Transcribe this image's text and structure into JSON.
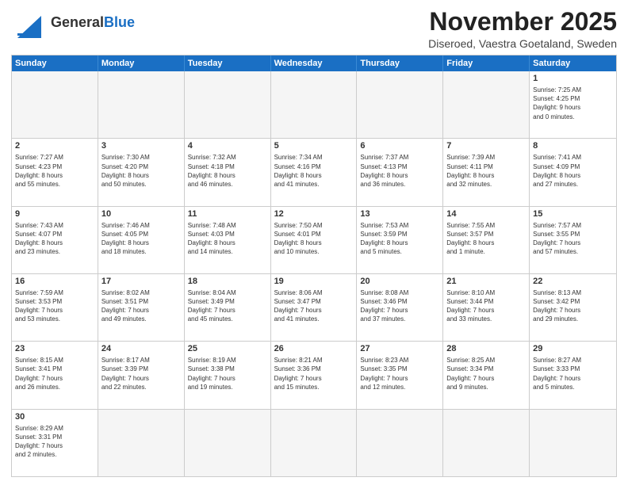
{
  "header": {
    "logo_general": "General",
    "logo_blue": "Blue",
    "month_title": "November 2025",
    "location": "Diseroed, Vaestra Goetaland, Sweden"
  },
  "day_headers": [
    "Sunday",
    "Monday",
    "Tuesday",
    "Wednesday",
    "Thursday",
    "Friday",
    "Saturday"
  ],
  "weeks": [
    [
      {
        "day": "",
        "info": ""
      },
      {
        "day": "",
        "info": ""
      },
      {
        "day": "",
        "info": ""
      },
      {
        "day": "",
        "info": ""
      },
      {
        "day": "",
        "info": ""
      },
      {
        "day": "",
        "info": ""
      },
      {
        "day": "1",
        "info": "Sunrise: 7:25 AM\nSunset: 4:25 PM\nDaylight: 9 hours\nand 0 minutes."
      }
    ],
    [
      {
        "day": "2",
        "info": "Sunrise: 7:27 AM\nSunset: 4:23 PM\nDaylight: 8 hours\nand 55 minutes."
      },
      {
        "day": "3",
        "info": "Sunrise: 7:30 AM\nSunset: 4:20 PM\nDaylight: 8 hours\nand 50 minutes."
      },
      {
        "day": "4",
        "info": "Sunrise: 7:32 AM\nSunset: 4:18 PM\nDaylight: 8 hours\nand 46 minutes."
      },
      {
        "day": "5",
        "info": "Sunrise: 7:34 AM\nSunset: 4:16 PM\nDaylight: 8 hours\nand 41 minutes."
      },
      {
        "day": "6",
        "info": "Sunrise: 7:37 AM\nSunset: 4:13 PM\nDaylight: 8 hours\nand 36 minutes."
      },
      {
        "day": "7",
        "info": "Sunrise: 7:39 AM\nSunset: 4:11 PM\nDaylight: 8 hours\nand 32 minutes."
      },
      {
        "day": "8",
        "info": "Sunrise: 7:41 AM\nSunset: 4:09 PM\nDaylight: 8 hours\nand 27 minutes."
      }
    ],
    [
      {
        "day": "9",
        "info": "Sunrise: 7:43 AM\nSunset: 4:07 PM\nDaylight: 8 hours\nand 23 minutes."
      },
      {
        "day": "10",
        "info": "Sunrise: 7:46 AM\nSunset: 4:05 PM\nDaylight: 8 hours\nand 18 minutes."
      },
      {
        "day": "11",
        "info": "Sunrise: 7:48 AM\nSunset: 4:03 PM\nDaylight: 8 hours\nand 14 minutes."
      },
      {
        "day": "12",
        "info": "Sunrise: 7:50 AM\nSunset: 4:01 PM\nDaylight: 8 hours\nand 10 minutes."
      },
      {
        "day": "13",
        "info": "Sunrise: 7:53 AM\nSunset: 3:59 PM\nDaylight: 8 hours\nand 5 minutes."
      },
      {
        "day": "14",
        "info": "Sunrise: 7:55 AM\nSunset: 3:57 PM\nDaylight: 8 hours\nand 1 minute."
      },
      {
        "day": "15",
        "info": "Sunrise: 7:57 AM\nSunset: 3:55 PM\nDaylight: 7 hours\nand 57 minutes."
      }
    ],
    [
      {
        "day": "16",
        "info": "Sunrise: 7:59 AM\nSunset: 3:53 PM\nDaylight: 7 hours\nand 53 minutes."
      },
      {
        "day": "17",
        "info": "Sunrise: 8:02 AM\nSunset: 3:51 PM\nDaylight: 7 hours\nand 49 minutes."
      },
      {
        "day": "18",
        "info": "Sunrise: 8:04 AM\nSunset: 3:49 PM\nDaylight: 7 hours\nand 45 minutes."
      },
      {
        "day": "19",
        "info": "Sunrise: 8:06 AM\nSunset: 3:47 PM\nDaylight: 7 hours\nand 41 minutes."
      },
      {
        "day": "20",
        "info": "Sunrise: 8:08 AM\nSunset: 3:46 PM\nDaylight: 7 hours\nand 37 minutes."
      },
      {
        "day": "21",
        "info": "Sunrise: 8:10 AM\nSunset: 3:44 PM\nDaylight: 7 hours\nand 33 minutes."
      },
      {
        "day": "22",
        "info": "Sunrise: 8:13 AM\nSunset: 3:42 PM\nDaylight: 7 hours\nand 29 minutes."
      }
    ],
    [
      {
        "day": "23",
        "info": "Sunrise: 8:15 AM\nSunset: 3:41 PM\nDaylight: 7 hours\nand 26 minutes."
      },
      {
        "day": "24",
        "info": "Sunrise: 8:17 AM\nSunset: 3:39 PM\nDaylight: 7 hours\nand 22 minutes."
      },
      {
        "day": "25",
        "info": "Sunrise: 8:19 AM\nSunset: 3:38 PM\nDaylight: 7 hours\nand 19 minutes."
      },
      {
        "day": "26",
        "info": "Sunrise: 8:21 AM\nSunset: 3:36 PM\nDaylight: 7 hours\nand 15 minutes."
      },
      {
        "day": "27",
        "info": "Sunrise: 8:23 AM\nSunset: 3:35 PM\nDaylight: 7 hours\nand 12 minutes."
      },
      {
        "day": "28",
        "info": "Sunrise: 8:25 AM\nSunset: 3:34 PM\nDaylight: 7 hours\nand 9 minutes."
      },
      {
        "day": "29",
        "info": "Sunrise: 8:27 AM\nSunset: 3:33 PM\nDaylight: 7 hours\nand 5 minutes."
      }
    ],
    [
      {
        "day": "30",
        "info": "Sunrise: 8:29 AM\nSunset: 3:31 PM\nDaylight: 7 hours\nand 2 minutes."
      },
      {
        "day": "",
        "info": ""
      },
      {
        "day": "",
        "info": ""
      },
      {
        "day": "",
        "info": ""
      },
      {
        "day": "",
        "info": ""
      },
      {
        "day": "",
        "info": ""
      },
      {
        "day": "",
        "info": ""
      }
    ]
  ]
}
